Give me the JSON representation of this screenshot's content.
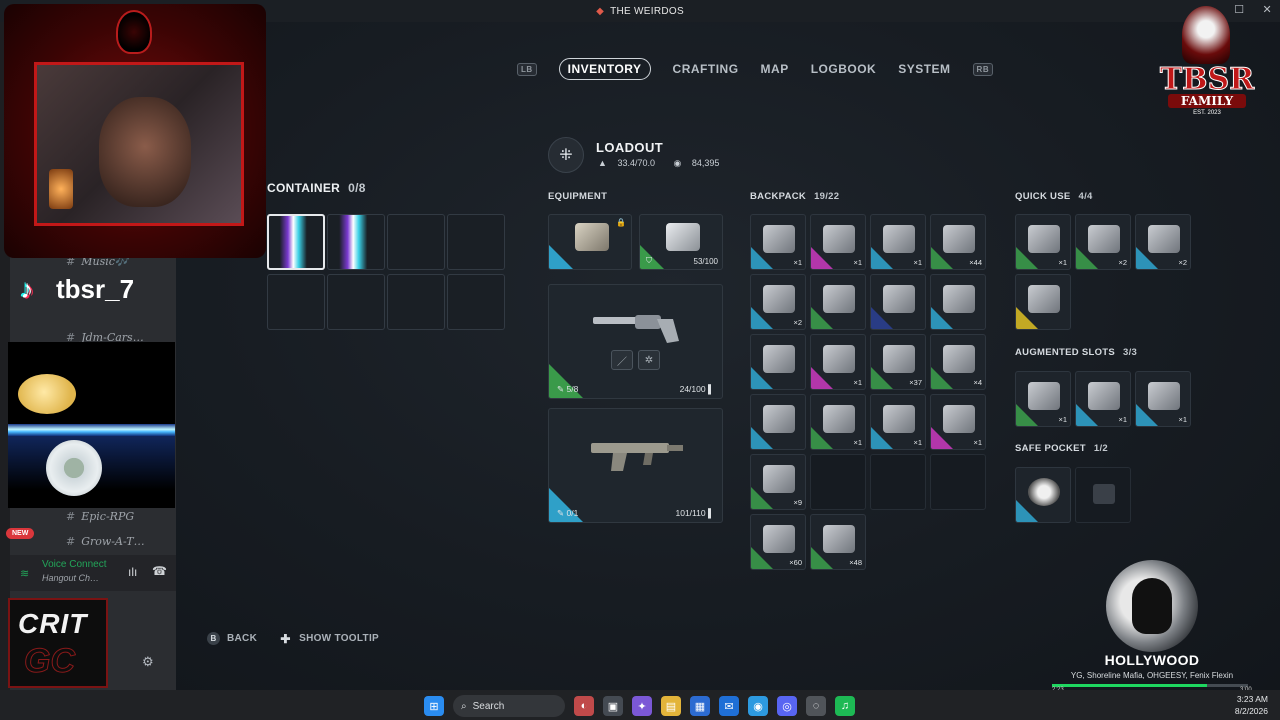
{
  "window": {
    "title": "THE WEIRDOS"
  },
  "nav": {
    "left_bumper": "LB",
    "right_bumper": "RB",
    "tabs": [
      {
        "label": "INVENTORY",
        "active": true
      },
      {
        "label": "CRAFTING"
      },
      {
        "label": "MAP"
      },
      {
        "label": "LOGBOOK"
      },
      {
        "label": "SYSTEM"
      }
    ]
  },
  "loadout": {
    "title": "LOADOUT",
    "weight": "33.4/70.0",
    "currency": "84,395"
  },
  "container": {
    "label": "CONTAINER",
    "count": "0/8"
  },
  "equipment": {
    "label": "EQUIPMENT",
    "shield_durability": "53/100",
    "primary": {
      "mods": "5/8",
      "ammo": "24/100"
    },
    "secondary": {
      "mods": "0/1",
      "ammo": "101/110"
    }
  },
  "backpack": {
    "label": "BACKPACK",
    "count": "19/22",
    "slots": [
      {
        "qty": "×1",
        "rarity": "#2fa0c8"
      },
      {
        "qty": "×1",
        "rarity": "#c238b8"
      },
      {
        "qty": "×1",
        "rarity": "#2fa0c8"
      },
      {
        "qty": "×44",
        "rarity": "#3a9a4a"
      },
      {
        "qty": "×2",
        "rarity": "#2fa0c8"
      },
      {
        "qty": "",
        "rarity": "#3a9a4a"
      },
      {
        "qty": "",
        "rarity": "#2a3f8f"
      },
      {
        "qty": "",
        "rarity": "#2fa0c8"
      },
      {
        "qty": "",
        "rarity": "#2fa0c8"
      },
      {
        "qty": "×1",
        "rarity": "#c238b8"
      },
      {
        "qty": "×37",
        "rarity": "#3a9a4a"
      },
      {
        "qty": "×4",
        "rarity": "#3a9a4a"
      },
      {
        "qty": "",
        "rarity": "#2fa0c8"
      },
      {
        "qty": "×1",
        "rarity": "#3a9a4a"
      },
      {
        "qty": "×1",
        "rarity": "#2fa0c8"
      },
      {
        "qty": "×1",
        "rarity": "#c238b8"
      },
      {
        "qty": "×9",
        "rarity": "#3a9a4a"
      },
      {
        "qty": "×60",
        "rarity": "#3a9a4a"
      },
      {
        "qty": "×48",
        "rarity": "#3a9a4a"
      }
    ]
  },
  "quick_use": {
    "label": "QUICK USE",
    "count": "4/4",
    "slots": [
      {
        "qty": "×1",
        "rarity": "#3a9a4a"
      },
      {
        "qty": "×2",
        "rarity": "#3a9a4a"
      },
      {
        "qty": "×2",
        "rarity": "#2fa0c8"
      },
      {
        "qty": "",
        "rarity": "#d4b823"
      }
    ]
  },
  "augmented": {
    "label": "AUGMENTED SLOTS",
    "count": "3/3",
    "slots": [
      {
        "qty": "×1",
        "rarity": "#3a9a4a"
      },
      {
        "qty": "×1",
        "rarity": "#2fa0c8"
      },
      {
        "qty": "×1",
        "rarity": "#2fa0c8"
      }
    ]
  },
  "safe_pocket": {
    "label": "SAFE POCKET",
    "count": "1/2"
  },
  "actions": {
    "back": "BACK",
    "back_key": "B",
    "tooltip": "SHOW TOOLTIP"
  },
  "discord": {
    "channels": [
      {
        "name": "Music🎶"
      },
      {
        "name": "Jdm-Cars…"
      },
      {
        "name": "Epic-RPG"
      },
      {
        "name": "Grow-A-T…"
      }
    ],
    "new_badge": "NEW",
    "voice": {
      "status": "Voice Connect",
      "channel": "Hangout Ch…"
    }
  },
  "tiktok": {
    "handle": "tbsr_7"
  },
  "crit": {
    "line1": "CRIT",
    "line2": "GC"
  },
  "tbsr": {
    "word": "TBSR",
    "family": "FAMILY",
    "est": "EST. 2023"
  },
  "now_playing": {
    "title": "HOLLYWOOD",
    "artists": "YG, Shoreline Mafia, OHGEESY, Fenix Flexin",
    "elapsed": "2:23",
    "total": "3:00",
    "progress": 0.79
  },
  "taskbar": {
    "search": "Search",
    "time": "3:23 AM",
    "date": "8/2/2026"
  }
}
